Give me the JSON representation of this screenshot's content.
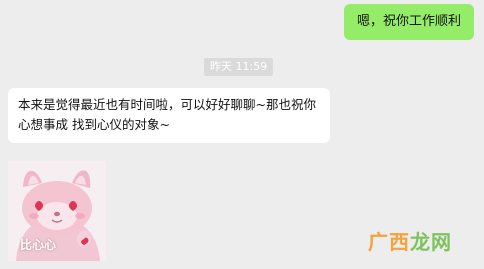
{
  "colors": {
    "background": "#ededed",
    "outgoing_bubble": "#95ec69",
    "incoming_bubble": "#ffffff",
    "timestamp_bg": "#dadada",
    "watermark_orange": "#f3a33b",
    "watermark_green": "#7ec25e"
  },
  "messages": {
    "outgoing_1": "嗯，祝你工作顺利",
    "timestamp": "昨天 11:59",
    "incoming_1": "本来是觉得最近也有时间啦，可以好好聊聊~那也祝你心想事成 找到心仪的对象~",
    "sticker_caption": "比心心"
  },
  "watermark": {
    "part1": "广西",
    "part2": "龙网"
  },
  "icons": {
    "sticker": "pink-fox-sticker-icon"
  }
}
